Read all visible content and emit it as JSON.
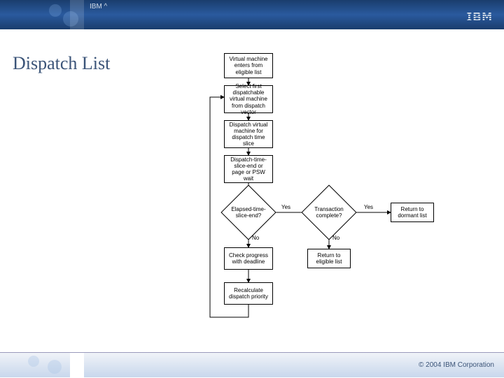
{
  "header": {
    "brand_short": "IBM ^",
    "logo_text": "IBM"
  },
  "page": {
    "title": "Dispatch List"
  },
  "flow": {
    "step1": "Virtual machine enters from eligible list",
    "step2": "Select first dispatchable virtual machine from dispatch vector",
    "step3": "Dispatch virtual machine for dispatch time slice",
    "step4": "Dispatch-time-slice-end or page or PSW wait",
    "decision1": "Elapsed-time-slice-end?",
    "decision2": "Transaction complete?",
    "step5": "Check progress with deadline",
    "step6": "Recalculate dispatch priority",
    "result1": "Return to dormant list",
    "result2": "Return to eligible list"
  },
  "labels": {
    "yes": "Yes",
    "no": "No"
  },
  "footer": {
    "copyright": "© 2004 IBM Corporation"
  }
}
